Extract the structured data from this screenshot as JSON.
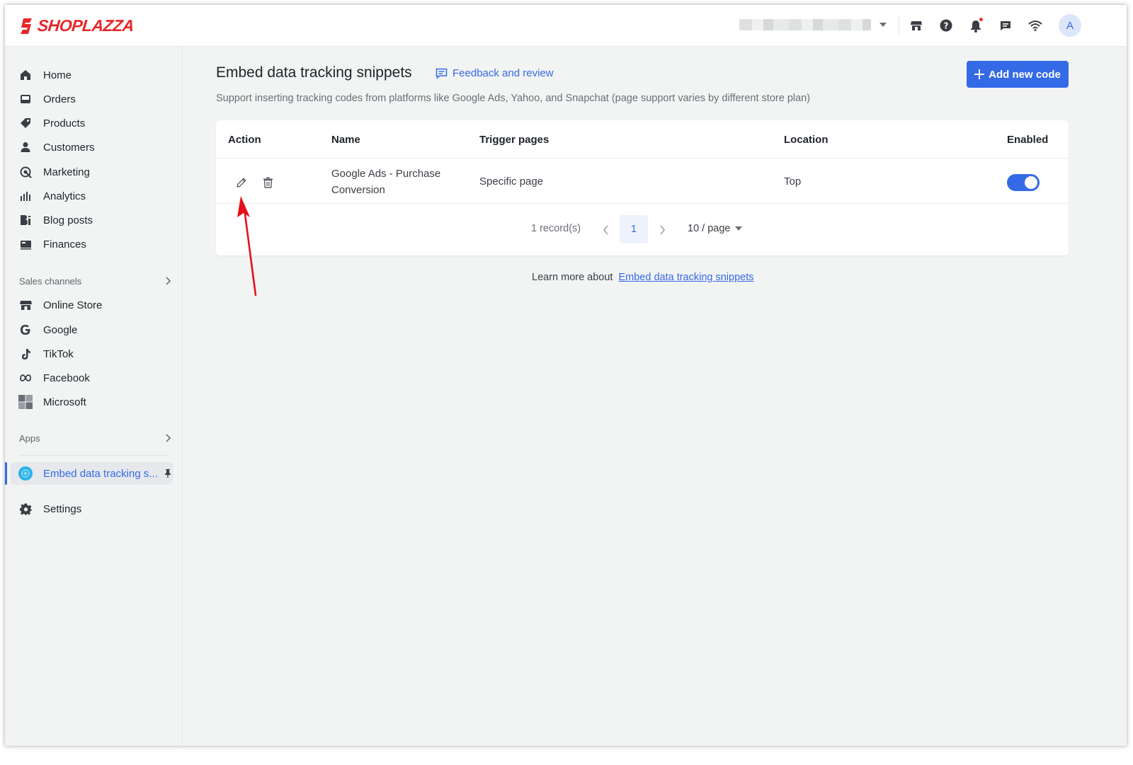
{
  "brand": {
    "logo_text": "SHOPLAZZA",
    "logo_color": "#e8272a"
  },
  "topbar": {
    "icons": [
      "store-icon",
      "help-icon",
      "bell-icon",
      "message-icon",
      "wifi-icon"
    ],
    "avatar_initial": "A"
  },
  "sidebar": {
    "items": [
      {
        "label": "Home",
        "icon": "home-icon"
      },
      {
        "label": "Orders",
        "icon": "orders-icon"
      },
      {
        "label": "Products",
        "icon": "tag-icon"
      },
      {
        "label": "Customers",
        "icon": "person-icon"
      },
      {
        "label": "Marketing",
        "icon": "marketing-icon"
      },
      {
        "label": "Analytics",
        "icon": "bar-chart-icon"
      },
      {
        "label": "Blog posts",
        "icon": "blog-icon"
      },
      {
        "label": "Finances",
        "icon": "finance-icon"
      }
    ],
    "sales_channels_label": "Sales channels",
    "channels": [
      {
        "label": "Online Store",
        "icon": "store-icon"
      },
      {
        "label": "Google",
        "icon": "google-icon"
      },
      {
        "label": "TikTok",
        "icon": "tiktok-icon"
      },
      {
        "label": "Facebook",
        "icon": "meta-icon"
      },
      {
        "label": "Microsoft",
        "icon": "microsoft-icon"
      }
    ],
    "apps_label": "Apps",
    "active_app": {
      "label": "Embed data tracking s...",
      "icon": "app-icon"
    },
    "settings_label": "Settings"
  },
  "main": {
    "title": "Embed data tracking snippets",
    "feedback_label": "Feedback and review",
    "subtitle": "Support inserting tracking codes from platforms like Google Ads, Yahoo, and Snapchat (page support varies by different store plan)",
    "add_button_label": "Add new code",
    "table": {
      "columns": [
        "Action",
        "Name",
        "Trigger pages",
        "Location",
        "Enabled"
      ],
      "rows": [
        {
          "name": "Google Ads - Purchase Conversion",
          "trigger_pages": "Specific page",
          "location": "Top",
          "enabled": true
        }
      ]
    },
    "pagination": {
      "records": "1 record(s)",
      "current_page": "1",
      "per_page": "10 / page"
    },
    "learn_more_prefix": "Learn more about",
    "learn_more_link": "Embed data tracking snippets"
  },
  "colors": {
    "accent": "#356ae6",
    "annotation": "#e3101b"
  }
}
